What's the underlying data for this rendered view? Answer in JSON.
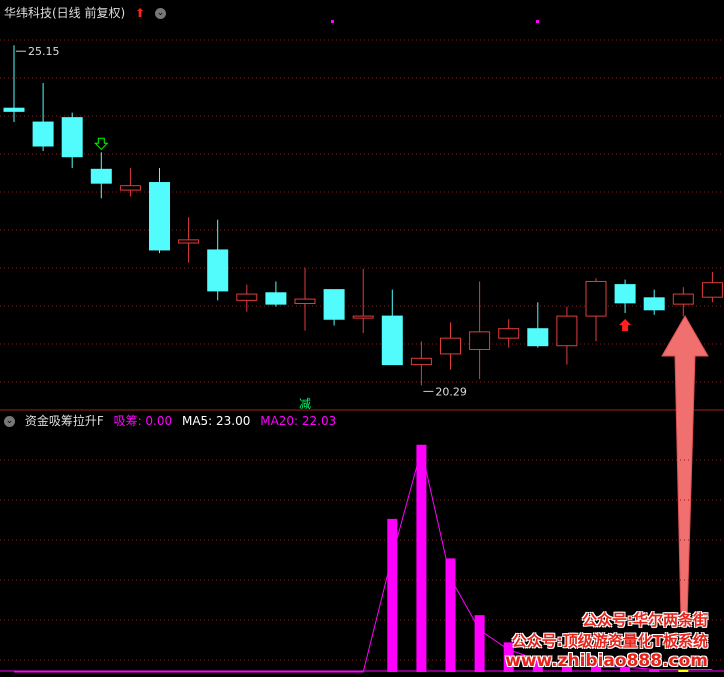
{
  "upper": {
    "title": "华纬科技(日线 前复权)",
    "high_label": "25.15",
    "low_label": "20.29",
    "event_label": "减",
    "colors": {
      "up": "#e03c3c",
      "down": "#52fcfc",
      "ma": "#ff00ff"
    },
    "candles": [
      {
        "o": 24.15,
        "h": 25.15,
        "l": 23.93,
        "c": 24.1
      },
      {
        "o": 23.93,
        "h": 24.55,
        "l": 23.47,
        "c": 23.55
      },
      {
        "o": 24.0,
        "h": 24.08,
        "l": 23.2,
        "c": 23.38
      },
      {
        "o": 23.18,
        "h": 23.45,
        "l": 22.72,
        "c": 22.96
      },
      {
        "o": 22.85,
        "h": 23.2,
        "l": 22.75,
        "c": 22.92
      },
      {
        "o": 22.97,
        "h": 23.2,
        "l": 21.85,
        "c": 21.9
      },
      {
        "o": 22.01,
        "h": 22.42,
        "l": 21.7,
        "c": 22.06
      },
      {
        "o": 21.9,
        "h": 22.38,
        "l": 21.1,
        "c": 21.25
      },
      {
        "o": 21.1,
        "h": 21.35,
        "l": 20.92,
        "c": 21.2
      },
      {
        "o": 21.22,
        "h": 21.4,
        "l": 21.0,
        "c": 21.04
      },
      {
        "o": 21.05,
        "h": 21.62,
        "l": 20.62,
        "c": 21.12
      },
      {
        "o": 21.27,
        "h": 21.27,
        "l": 20.7,
        "c": 20.8
      },
      {
        "o": 20.82,
        "h": 21.6,
        "l": 20.58,
        "c": 20.85
      },
      {
        "o": 20.85,
        "h": 21.27,
        "l": 20.23,
        "c": 20.08
      },
      {
        "o": 20.08,
        "h": 20.45,
        "l": 19.75,
        "c": 20.18
      },
      {
        "o": 20.25,
        "h": 20.75,
        "l": 20.0,
        "c": 20.5
      },
      {
        "o": 20.32,
        "h": 21.4,
        "l": 19.85,
        "c": 20.6
      },
      {
        "o": 20.5,
        "h": 20.8,
        "l": 20.35,
        "c": 20.65
      },
      {
        "o": 20.65,
        "h": 21.07,
        "l": 20.35,
        "c": 20.38
      },
      {
        "o": 20.38,
        "h": 21.0,
        "l": 20.08,
        "c": 20.85
      },
      {
        "o": 20.85,
        "h": 21.45,
        "l": 20.45,
        "c": 21.4
      },
      {
        "o": 21.35,
        "h": 21.43,
        "l": 20.9,
        "c": 21.06
      },
      {
        "o": 21.14,
        "h": 21.27,
        "l": 20.87,
        "c": 20.95
      },
      {
        "o": 21.04,
        "h": 21.31,
        "l": 20.85,
        "c": 21.2
      },
      {
        "o": 21.15,
        "h": 21.55,
        "l": 21.07,
        "c": 21.38
      }
    ],
    "markers": [
      {
        "index": 3,
        "type": "down-arrow",
        "color": "#00ff00"
      },
      {
        "index": 21,
        "type": "up-arrow",
        "color": "#ff2020"
      }
    ]
  },
  "lower": {
    "indicator": "资金吸筹拉升F",
    "values": [
      {
        "label": "吸筹: 0.00",
        "color": "#ff00ff"
      },
      {
        "label": "MA5: 23.00",
        "color": "#ffffff"
      },
      {
        "label": "MA20: 22.03",
        "color": "#ff00ff"
      }
    ],
    "bars": [
      0,
      0,
      0,
      0,
      0,
      0,
      0,
      0,
      0,
      0,
      0,
      0,
      0,
      62,
      92,
      46,
      23,
      12,
      6,
      3,
      3,
      2,
      1,
      1,
      0
    ],
    "yellow_bar_index": 23,
    "ma_line": [
      0,
      0,
      0,
      0,
      0,
      0,
      0,
      0,
      0,
      0,
      0,
      0,
      0,
      47,
      90,
      38,
      17,
      9,
      5,
      3,
      2,
      2,
      1,
      1,
      1
    ],
    "colors": {
      "bar": "#ff00ff",
      "line": "#ff00ff",
      "highlight": "#ffff00"
    }
  },
  "watermark": {
    "line1": "公众号:华尔两条街",
    "line2": "公众号:顶级游资量化T板系统",
    "line3": "www.zhibiao888.com"
  }
}
